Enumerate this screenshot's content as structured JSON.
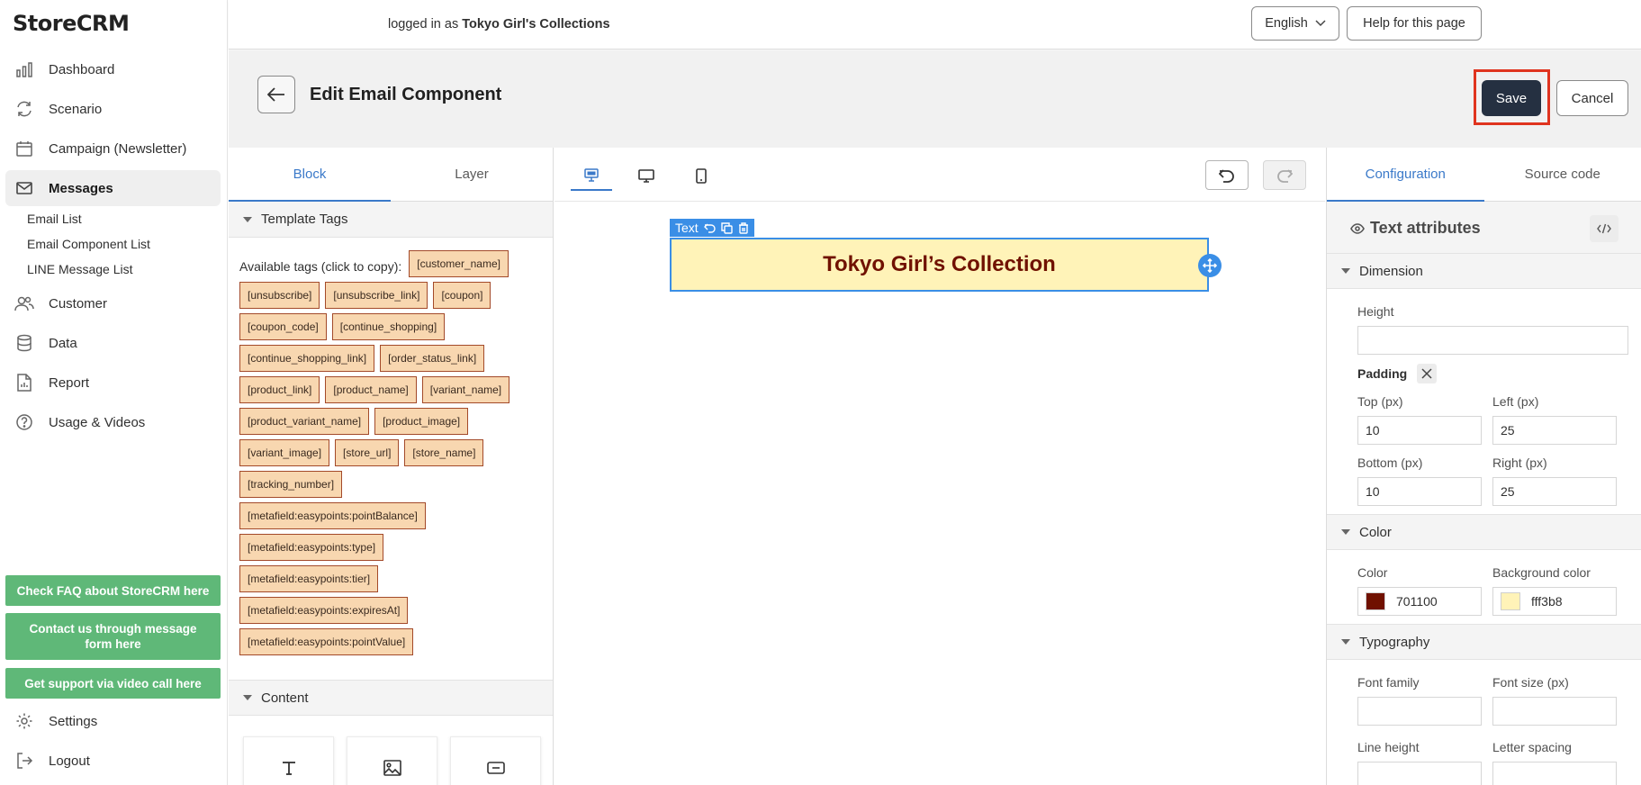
{
  "app": {
    "logo": "StoreCRM"
  },
  "sidebar": {
    "items": [
      {
        "label": "Dashboard",
        "icon": "chart-icon"
      },
      {
        "label": "Scenario",
        "icon": "refresh-icon"
      },
      {
        "label": "Campaign (Newsletter)",
        "icon": "calendar-icon"
      },
      {
        "label": "Messages",
        "icon": "mail-icon"
      },
      {
        "label": "Customer",
        "icon": "users-icon"
      },
      {
        "label": "Data",
        "icon": "database-icon"
      },
      {
        "label": "Report",
        "icon": "report-icon"
      },
      {
        "label": "Usage & Videos",
        "icon": "help-icon"
      },
      {
        "label": "Settings",
        "icon": "gear-icon"
      },
      {
        "label": "Logout",
        "icon": "logout-icon"
      }
    ],
    "sub_items": [
      "Email List",
      "Email Component List",
      "LINE Message List"
    ],
    "support_buttons": [
      "Check FAQ about StoreCRM here",
      "Contact us through message form here",
      "Get support via video call here"
    ]
  },
  "topbar": {
    "logged_prefix": "logged in as",
    "store_name": "Tokyo Girl's Collections",
    "language": "English",
    "help": "Help for this page"
  },
  "header": {
    "title": "Edit Email Component",
    "save": "Save",
    "cancel": "Cancel"
  },
  "left_panel": {
    "tabs": [
      "Block",
      "Layer"
    ],
    "template_tags_title": "Template Tags",
    "available_label": "Available tags (click to copy):",
    "tags": [
      "[customer_name]",
      "[unsubscribe]",
      "[unsubscribe_link]",
      "[coupon]",
      "[coupon_code]",
      "[continue_shopping]",
      "[continue_shopping_link]",
      "[order_status_link]",
      "[product_link]",
      "[product_name]",
      "[variant_name]",
      "[product_variant_name]",
      "[product_image]",
      "[variant_image]",
      "[store_url]",
      "[store_name]",
      "[tracking_number]",
      "[metafield:easypoints:pointBalance]",
      "[metafield:easypoints:type]",
      "[metafield:easypoints:tier]",
      "[metafield:easypoints:expiresAt]",
      "[metafield:easypoints:pointValue]"
    ],
    "content_title": "Content"
  },
  "canvas": {
    "badge_label": "Text",
    "text_content": "Tokyo Girl’s Collection",
    "text_color": "#701100",
    "background_color": "#fff3b8"
  },
  "right_panel": {
    "tabs": [
      "Configuration",
      "Source code"
    ],
    "title": "Text attributes",
    "dimension": {
      "title": "Dimension",
      "height_label": "Height",
      "height_value": "",
      "padding_label": "Padding",
      "top_label": "Top (px)",
      "top_value": "10",
      "left_label": "Left (px)",
      "left_value": "25",
      "bottom_label": "Bottom (px)",
      "bottom_value": "10",
      "right_label": "Right (px)",
      "right_value": "25"
    },
    "color": {
      "title": "Color",
      "color_label": "Color",
      "color_value": "701100",
      "color_hex": "#701100",
      "bg_label": "Background color",
      "bg_value": "fff3b8",
      "bg_hex": "#fff3b8"
    },
    "typography": {
      "title": "Typography",
      "font_family_label": "Font family",
      "font_size_label": "Font size (px)",
      "line_height_label": "Line height",
      "letter_spacing_label": "Letter spacing"
    }
  }
}
